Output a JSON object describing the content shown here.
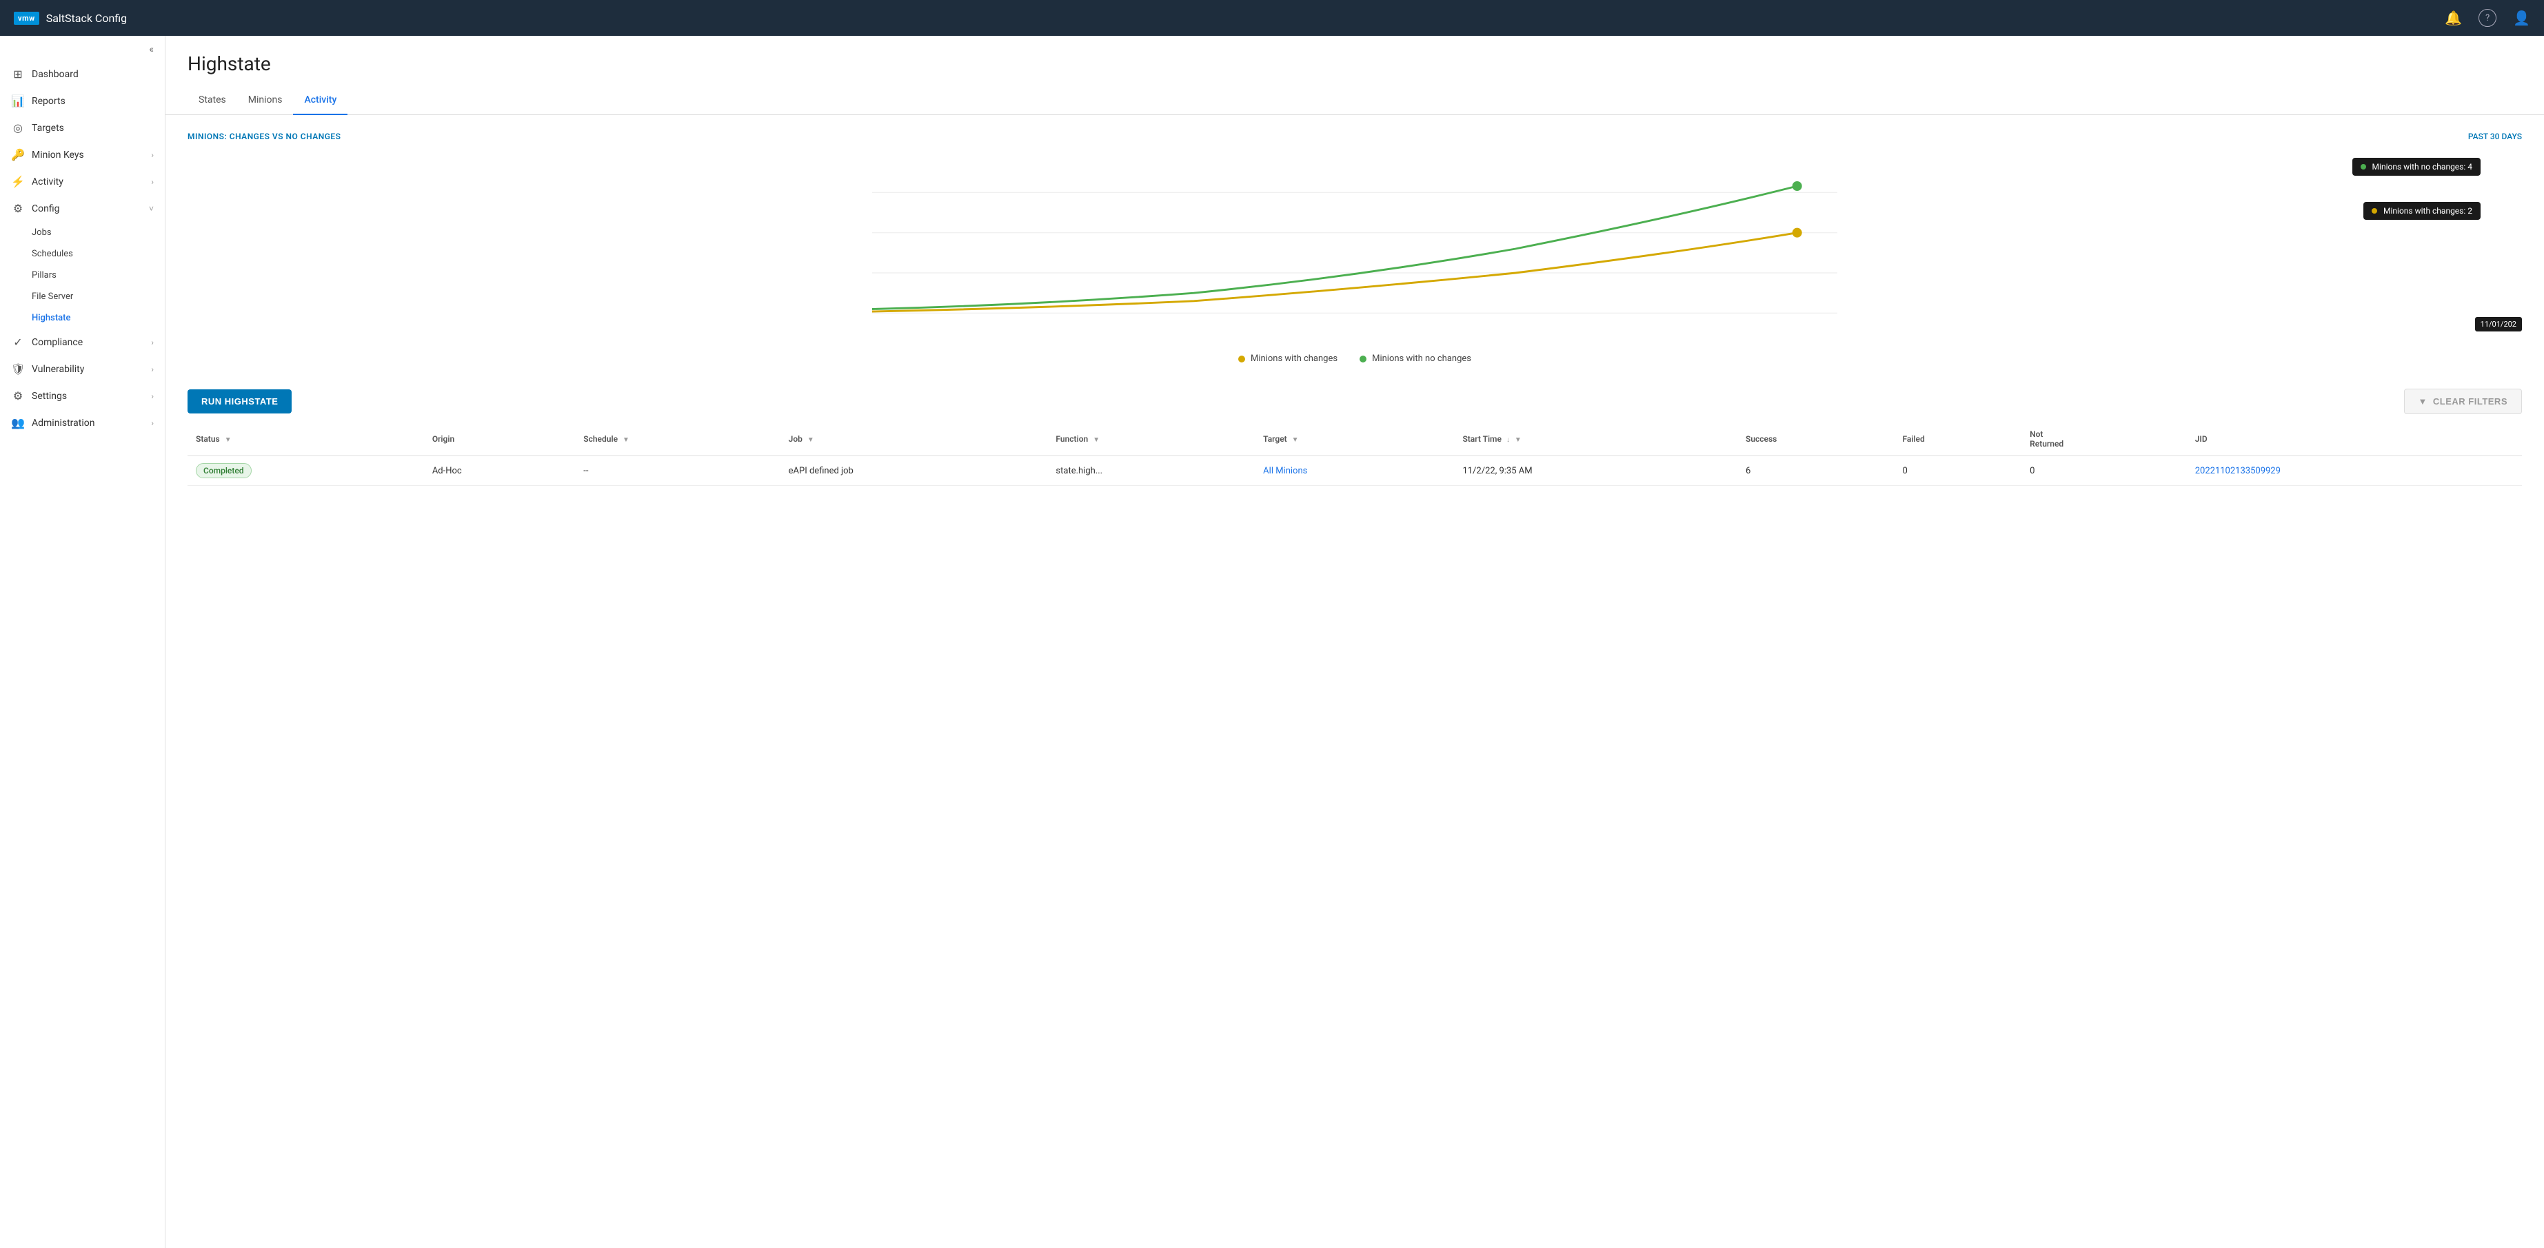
{
  "app": {
    "logo": "vmw",
    "title": "SaltStack Config"
  },
  "topbar": {
    "notification_icon": "🔔",
    "help_icon": "?",
    "user_icon": "👤"
  },
  "sidebar": {
    "collapse_label": "«",
    "items": [
      {
        "id": "dashboard",
        "label": "Dashboard",
        "icon": "⊞",
        "has_arrow": false
      },
      {
        "id": "reports",
        "label": "Reports",
        "icon": "📊",
        "has_arrow": false
      },
      {
        "id": "targets",
        "label": "Targets",
        "icon": "◎",
        "has_arrow": false
      },
      {
        "id": "minion-keys",
        "label": "Minion Keys",
        "icon": "🔑",
        "has_arrow": true
      },
      {
        "id": "activity",
        "label": "Activity",
        "icon": "⚡",
        "has_arrow": true
      },
      {
        "id": "config",
        "label": "Config",
        "icon": "⚙",
        "has_arrow": true,
        "expanded": true
      }
    ],
    "config_sub_items": [
      {
        "id": "jobs",
        "label": "Jobs"
      },
      {
        "id": "schedules",
        "label": "Schedules"
      },
      {
        "id": "pillars",
        "label": "Pillars"
      },
      {
        "id": "file-server",
        "label": "File Server"
      },
      {
        "id": "highstate",
        "label": "Highstate",
        "active": true
      }
    ],
    "bottom_items": [
      {
        "id": "compliance",
        "label": "Compliance",
        "icon": "✓",
        "has_arrow": true
      },
      {
        "id": "vulnerability",
        "label": "Vulnerability",
        "icon": "🛡",
        "has_arrow": true
      },
      {
        "id": "settings",
        "label": "Settings",
        "icon": "⚙",
        "has_arrow": true
      },
      {
        "id": "administration",
        "label": "Administration",
        "icon": "👥",
        "has_arrow": true
      }
    ]
  },
  "page": {
    "title": "Highstate",
    "tabs": [
      {
        "id": "states",
        "label": "States"
      },
      {
        "id": "minions",
        "label": "Minions"
      },
      {
        "id": "activity",
        "label": "Activity",
        "active": true
      }
    ]
  },
  "chart": {
    "title": "MINIONS: CHANGES VS NO CHANGES",
    "period": "PAST 30 DAYS",
    "legend": [
      {
        "label": "Minions with changes",
        "color": "#d4a800"
      },
      {
        "label": "Minions with no changes",
        "color": "#4caf50"
      }
    ],
    "tooltip_no_changes": "Minions with no changes: 4",
    "tooltip_changes": "Minions with changes: 2",
    "date_tooltip": "11/01/202"
  },
  "actions": {
    "run_highstate_label": "RUN HIGHSTATE",
    "clear_filters_label": "CLEAR FILTERS"
  },
  "table": {
    "columns": [
      {
        "id": "status",
        "label": "Status",
        "has_filter": true,
        "has_sort": false
      },
      {
        "id": "origin",
        "label": "Origin",
        "has_filter": false,
        "has_sort": false
      },
      {
        "id": "schedule",
        "label": "Schedule",
        "has_filter": true,
        "has_sort": false
      },
      {
        "id": "job",
        "label": "Job",
        "has_filter": true,
        "has_sort": false
      },
      {
        "id": "function",
        "label": "Function",
        "has_filter": true,
        "has_sort": false
      },
      {
        "id": "target",
        "label": "Target",
        "has_filter": true,
        "has_sort": false
      },
      {
        "id": "start_time",
        "label": "Start Time",
        "has_filter": true,
        "has_sort": true
      },
      {
        "id": "success",
        "label": "Success",
        "has_filter": false,
        "has_sort": false
      },
      {
        "id": "failed",
        "label": "Failed",
        "has_filter": false,
        "has_sort": false
      },
      {
        "id": "not_returned",
        "label": "Not Returned",
        "has_filter": false,
        "has_sort": false
      },
      {
        "id": "jid",
        "label": "JID",
        "has_filter": false,
        "has_sort": false
      }
    ],
    "rows": [
      {
        "status": "Completed",
        "status_type": "completed",
        "origin": "Ad-Hoc",
        "schedule": "--",
        "job": "eAPI defined job",
        "function": "state.high...",
        "target": "All Minions",
        "start_time": "11/2/22, 9:35 AM",
        "success": "6",
        "failed": "0",
        "not_returned": "0",
        "jid": "20221102133509929",
        "jid_link": true,
        "target_link": true
      }
    ]
  }
}
